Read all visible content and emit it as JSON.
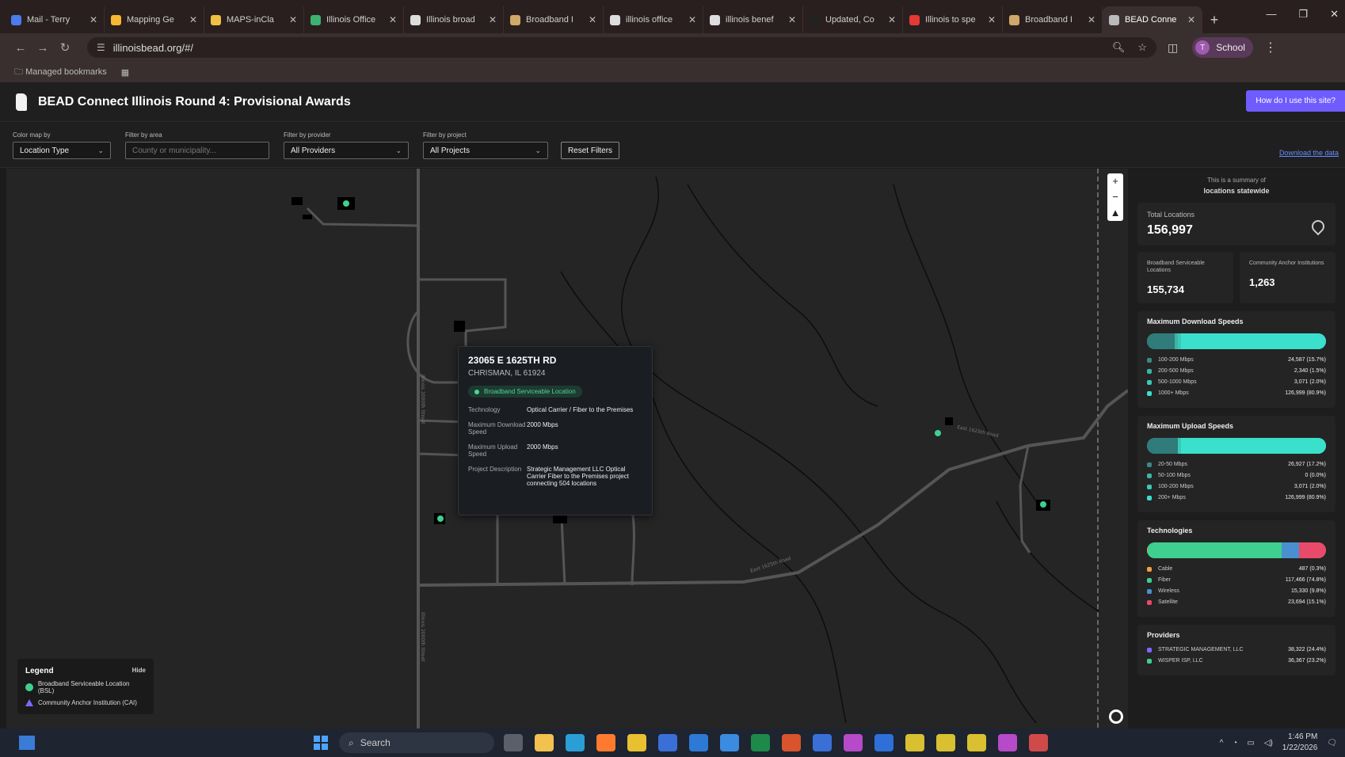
{
  "browser": {
    "tabs": [
      {
        "title": "Mail - Terry",
        "color": "#4b7bec"
      },
      {
        "title": "Mapping Ge",
        "color": "#f7b731"
      },
      {
        "title": "MAPS-inCla",
        "color": "#f0c040"
      },
      {
        "title": "Illinois Office",
        "color": "#3cb371"
      },
      {
        "title": "Illinois broad",
        "color": "#dddddd"
      },
      {
        "title": "Broadband I",
        "color": "#cfa96a"
      },
      {
        "title": "illinois office",
        "color": "#dddddd"
      },
      {
        "title": "illinois benef",
        "color": "#dddddd"
      },
      {
        "title": "Updated, Co",
        "color": "#222222"
      },
      {
        "title": "Illinois to spe",
        "color": "#e53935"
      },
      {
        "title": "Broadband I",
        "color": "#cfa96a"
      },
      {
        "title": "BEAD Conne",
        "color": "#bbbbbb"
      }
    ],
    "url": "illinoisbead.org/#/",
    "profile": "School",
    "profile_initial": "T",
    "bookmarks_label": "Managed bookmarks"
  },
  "app": {
    "title": "BEAD Connect Illinois Round 4: Provisional Awards",
    "help_button": "How do I use this site?"
  },
  "filters": {
    "color_label": "Color map by",
    "color_value": "Location Type",
    "area_label": "Filter by area",
    "area_placeholder": "County or municipality...",
    "provider_label": "Filter by provider",
    "provider_value": "All Providers",
    "project_label": "Filter by project",
    "project_value": "All Projects",
    "reset": "Reset Filters",
    "download": "Download the data"
  },
  "map": {
    "road_labels": [
      "Illinois 2000th Street",
      "East 1625th Road",
      "East 1625th Road",
      "Illinois 2000th Street"
    ],
    "popup": {
      "address": "23065 E 1625TH RD",
      "city": "CHRISMAN, IL 61924",
      "badge": "Broadband Serviceable Location",
      "rows": [
        {
          "k": "Technology",
          "v": "Optical Carrier / Fiber to the Premises"
        },
        {
          "k": "Maximum Download Speed",
          "v": "2000 Mbps"
        },
        {
          "k": "Maximum Upload Speed",
          "v": "2000 Mbps"
        },
        {
          "k": "Project Description",
          "v": "Strategic Management LLC Optical Carrier Fiber to the Premises project connecting 504 locations"
        }
      ]
    },
    "legend": {
      "title": "Legend",
      "hide": "Hide",
      "items": [
        {
          "label": "Broadband Serviceable Location (BSL)",
          "color": "#3fcf8e"
        },
        {
          "label": "Community Anchor Institution (CAI)",
          "color": "#7a6aff"
        }
      ]
    }
  },
  "summary": {
    "intro": "This is a summary of",
    "intro_bold": "locations statewide",
    "total_label": "Total Locations",
    "total_value": "156,997",
    "bsl_label": "Broadband Serviceable Locations",
    "bsl_value": "155,734",
    "cai_label": "Community Anchor Institutions",
    "cai_value": "1,263",
    "download": {
      "title": "Maximum Download Speeds",
      "rows": [
        {
          "label": "100-200 Mbps",
          "value": "24,587 (15.7%)",
          "color": "#3a8a86"
        },
        {
          "label": "200-500 Mbps",
          "value": "2,340 (1.5%)",
          "color": "#3fb3a5"
        },
        {
          "label": "500-1000 Mbps",
          "value": "3,071 (2.0%)",
          "color": "#3bc9b5"
        },
        {
          "label": "1000+ Mbps",
          "value": "126,999 (80.9%)",
          "color": "#3be0cc"
        }
      ]
    },
    "upload": {
      "title": "Maximum Upload Speeds",
      "rows": [
        {
          "label": "20-50 Mbps",
          "value": "26,927 (17.2%)",
          "color": "#3a8a86"
        },
        {
          "label": "50-100 Mbps",
          "value": "0 (0.0%)",
          "color": "#3fb3a5"
        },
        {
          "label": "100-200 Mbps",
          "value": "3,071 (2.0%)",
          "color": "#3bc9b5"
        },
        {
          "label": "200+ Mbps",
          "value": "126,999 (80.9%)",
          "color": "#3be0cc"
        }
      ]
    },
    "tech": {
      "title": "Technologies",
      "rows": [
        {
          "label": "Cable",
          "value": "487 (0.3%)",
          "color": "#f0a040"
        },
        {
          "label": "Fiber",
          "value": "117,466 (74.8%)",
          "color": "#3fcf8e"
        },
        {
          "label": "Wireless",
          "value": "15,330 (9.8%)",
          "color": "#4a90d0"
        },
        {
          "label": "Satellite",
          "value": "23,694 (15.1%)",
          "color": "#e84a6a"
        }
      ]
    },
    "providers": {
      "title": "Providers",
      "rows": [
        {
          "label": "STRATEGIC MANAGEMENT, LLC",
          "value": "38,322 (24.4%)",
          "color": "#7a6aff"
        },
        {
          "label": "WISPER ISP, LLC",
          "value": "36,367 (23.2%)",
          "color": "#3fcf8e"
        }
      ]
    }
  },
  "taskbar": {
    "search": "Search",
    "time": "1:46 PM",
    "date": "1/22/2026"
  }
}
